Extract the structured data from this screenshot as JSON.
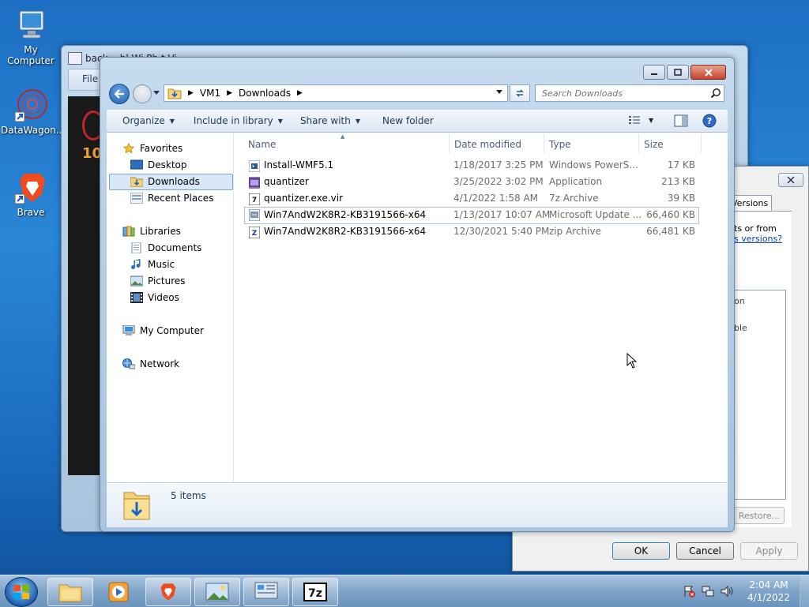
{
  "desktop": {
    "icons": [
      {
        "label": "My Computer"
      },
      {
        "label": "DataWagon..."
      },
      {
        "label": "Brave"
      }
    ]
  },
  "background_window": {
    "title": "back                 ...bl   Wi      Ph  t  Vi",
    "menu_file": "File"
  },
  "properties_dialog": {
    "tab_label": "Versions",
    "text_line1": "ts or from",
    "link_text": "s versions?",
    "list_text1": "on",
    "list_text2": "ble",
    "restore_button": "Restore...",
    "ok_button": "OK",
    "cancel_button": "Cancel",
    "apply_button": "Apply"
  },
  "explorer": {
    "breadcrumb": [
      "VM1",
      "Downloads"
    ],
    "search_placeholder": "Search Downloads",
    "toolbar": {
      "organize": "Organize",
      "include_in_library": "Include in library",
      "share_with": "Share with",
      "new_folder": "New folder"
    },
    "nav": {
      "favorites": "Favorites",
      "desktop": "Desktop",
      "downloads": "Downloads",
      "recent_places": "Recent Places",
      "libraries": "Libraries",
      "documents": "Documents",
      "music": "Music",
      "pictures": "Pictures",
      "videos": "Videos",
      "my_computer": "My Computer",
      "network": "Network"
    },
    "columns": {
      "name": "Name",
      "date_modified": "Date modified",
      "type": "Type",
      "size": "Size"
    },
    "files": [
      {
        "name": "Install-WMF5.1",
        "date": "1/18/2017 3:25 PM",
        "type": "Windows PowerS...",
        "size": "17 KB",
        "icon": "powershell-script-icon"
      },
      {
        "name": "quantizer",
        "date": "3/25/2022 3:02 PM",
        "type": "Application",
        "size": "213 KB",
        "icon": "application-icon"
      },
      {
        "name": "quantizer.exe.vir",
        "date": "4/1/2022 1:58 AM",
        "type": "7z Archive",
        "size": "39 KB",
        "icon": "7z-archive-icon"
      },
      {
        "name": "Win7AndW2K8R2-KB3191566-x64",
        "date": "1/13/2017 10:07 AM",
        "type": "Microsoft Update ...",
        "size": "66,460 KB",
        "icon": "update-package-icon"
      },
      {
        "name": "Win7AndW2K8R2-KB3191566-x64",
        "date": "12/30/2021 5:40 PM",
        "type": "zip Archive",
        "size": "66,481 KB",
        "icon": "zip-archive-icon"
      }
    ],
    "status_count": "5 items"
  },
  "taskbar": {
    "time": "2:04 AM",
    "date": "4/1/2022"
  }
}
